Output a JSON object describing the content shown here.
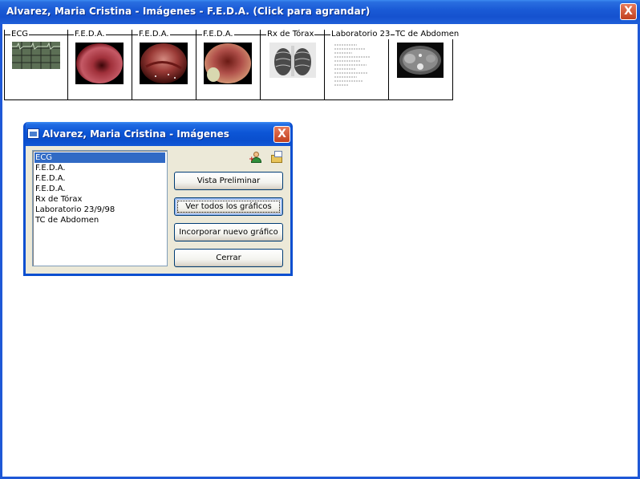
{
  "window": {
    "title": "Alvarez, Maria Cristina - Imágenes - F.E.D.A.  (Click para agrandar)",
    "close_label": "X"
  },
  "thumbnails": [
    {
      "label": "ECG",
      "icon": "ecg-image"
    },
    {
      "label": "F.E.D.A.",
      "icon": "endoscopy-image"
    },
    {
      "label": "F.E.D.A.",
      "icon": "endoscopy-image"
    },
    {
      "label": "F.E.D.A.",
      "icon": "endoscopy-image"
    },
    {
      "label": "Rx de Tórax",
      "icon": "chest-xray-image"
    },
    {
      "label": "Laboratorio 23",
      "icon": "lab-document-image"
    },
    {
      "label": "TC de Abdomen",
      "icon": "ct-scan-image"
    }
  ],
  "dialog": {
    "title": "Alvarez, Maria Cristina - Imágenes",
    "close_label": "X",
    "list_items": [
      "ECG",
      "F.E.D.A.",
      "F.E.D.A.",
      "F.E.D.A.",
      "Rx de Tórax",
      "Laboratorio 23/9/98",
      "TC de Abdomen"
    ],
    "selected_index": 0,
    "buttons": {
      "preview": "Vista Preliminar",
      "view_all": "Ver todos los gráficos",
      "add_new": "Incorporar nuevo gráfico",
      "close": "Cerrar"
    },
    "tool_icons": [
      "user-add-icon",
      "properties-icon"
    ]
  },
  "colors": {
    "titlebar": "#1a5ad6",
    "selection": "#316ac5",
    "dialog_bg": "#ece9d8"
  }
}
